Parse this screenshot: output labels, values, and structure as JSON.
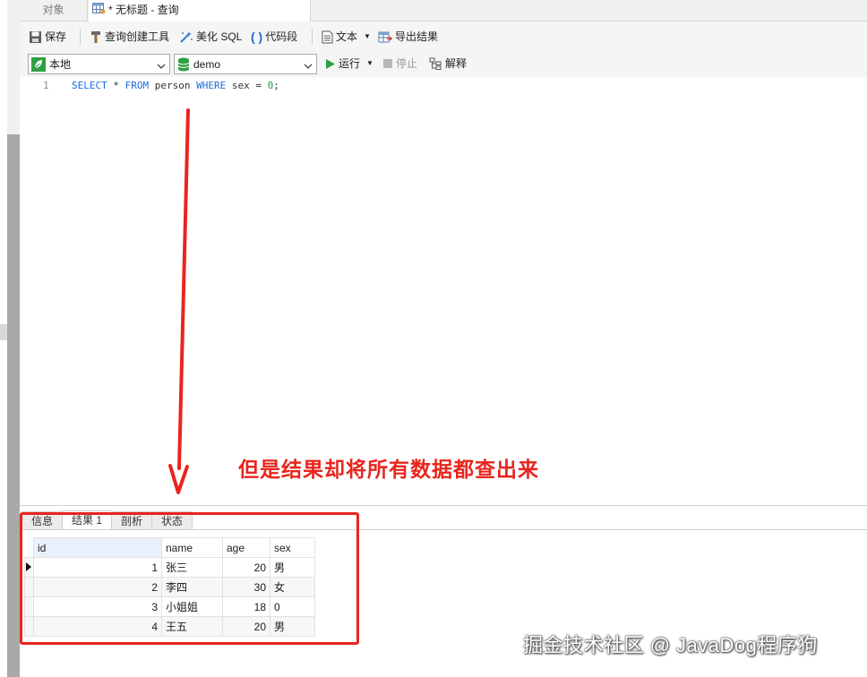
{
  "tabs": {
    "objects": "对象",
    "query": "* 无标题 - 查询"
  },
  "toolbar": {
    "save": "保存",
    "query_builder": "查询创建工具",
    "beautify_sql": "美化 SQL",
    "code_snippet": "代码段",
    "text": "文本",
    "export_results": "导出结果"
  },
  "connection": {
    "connection_value": "本地",
    "database_value": "demo",
    "run": "运行",
    "stop": "停止",
    "explain": "解释"
  },
  "editor": {
    "line_number": "1",
    "sql_tokens": [
      {
        "text": "SELECT",
        "kind": "kw"
      },
      {
        "text": " * ",
        "kind": "plain"
      },
      {
        "text": "FROM",
        "kind": "kw"
      },
      {
        "text": " person ",
        "kind": "plain"
      },
      {
        "text": "WHERE",
        "kind": "kw"
      },
      {
        "text": " sex = ",
        "kind": "plain"
      },
      {
        "text": "0",
        "kind": "num"
      },
      {
        "text": ";",
        "kind": "plain"
      }
    ]
  },
  "annotation": {
    "text": "但是结果却将所有数据都查出来",
    "color": "#e8251e"
  },
  "result_panel": {
    "tabs": [
      {
        "label": "信息",
        "active": false
      },
      {
        "label": "结果 1",
        "active": true
      },
      {
        "label": "剖析",
        "active": false
      },
      {
        "label": "状态",
        "active": false
      }
    ],
    "columns": [
      "id",
      "name",
      "age",
      "sex"
    ],
    "rows": [
      [
        "1",
        "张三",
        "20",
        "男"
      ],
      [
        "2",
        "李四",
        "30",
        "女"
      ],
      [
        "3",
        "小姐姐",
        "18",
        "0"
      ],
      [
        "4",
        "王五",
        "20",
        "男"
      ]
    ]
  },
  "watermark": "掘金技术社区 @ JavaDog程序狗",
  "colors": {
    "keyword": "#1d6bd8",
    "number": "#18a54a",
    "highlight_red": "#e8251e"
  }
}
